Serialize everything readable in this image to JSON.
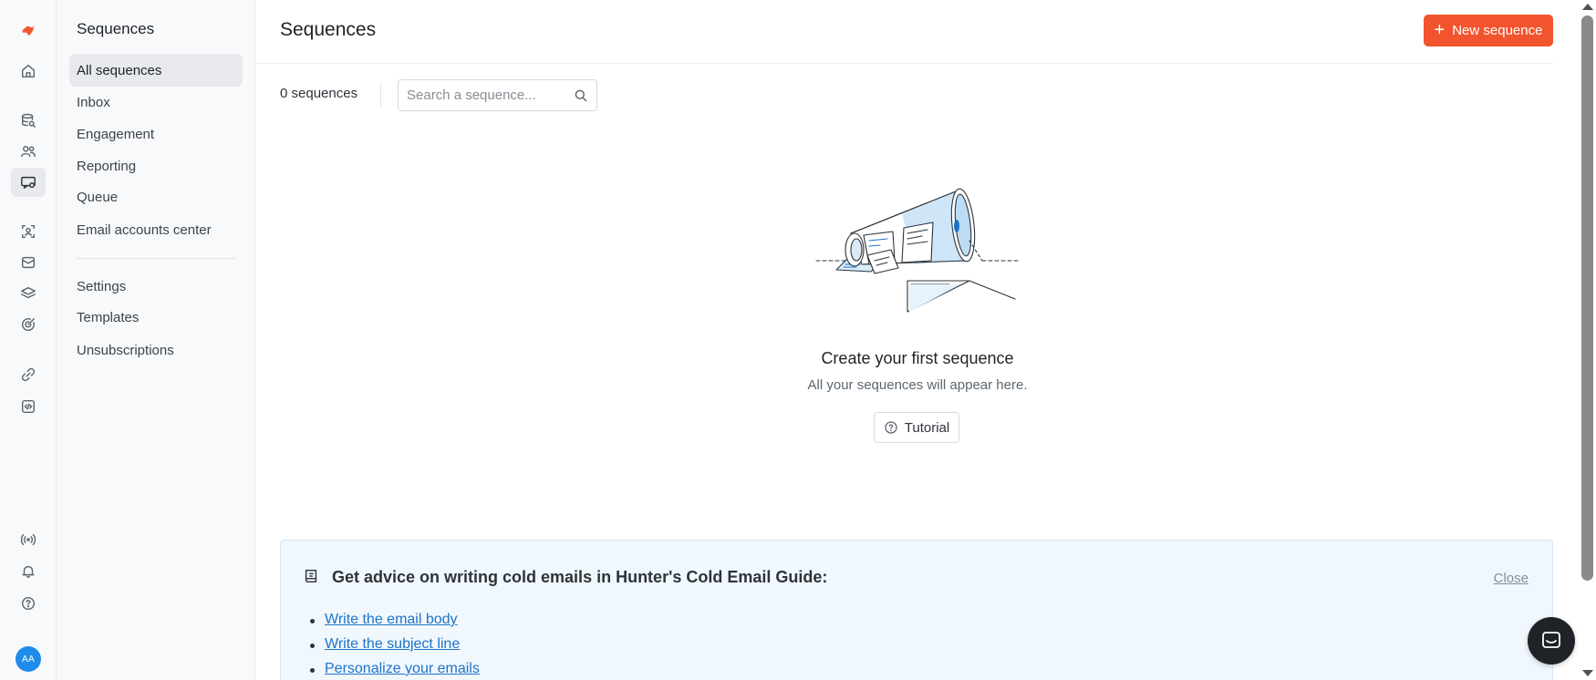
{
  "rail": {
    "logo_icon": "hunter-logo-icon",
    "items": [
      {
        "icon": "home-icon"
      },
      {
        "icon": "database-search-icon"
      },
      {
        "icon": "people-icon"
      },
      {
        "icon": "sequences-icon",
        "active": true
      },
      {
        "icon": "face-scan-icon"
      },
      {
        "icon": "mail-icon"
      },
      {
        "icon": "layers-icon"
      },
      {
        "icon": "target-icon"
      },
      {
        "icon": "integrations-icon"
      },
      {
        "icon": "api-icon"
      }
    ],
    "bottom": [
      {
        "icon": "broadcast-icon"
      },
      {
        "icon": "bell-icon"
      },
      {
        "icon": "help-icon"
      }
    ],
    "avatar_initials": "AA"
  },
  "subnav": {
    "title": "Sequences",
    "items": [
      {
        "label": "All sequences",
        "active": true
      },
      {
        "label": "Inbox"
      },
      {
        "label": "Engagement"
      },
      {
        "label": "Reporting"
      },
      {
        "label": "Queue"
      },
      {
        "label": "Email accounts center"
      }
    ],
    "settings_items": [
      {
        "label": "Settings"
      },
      {
        "label": "Templates"
      },
      {
        "label": "Unsubscriptions"
      }
    ]
  },
  "header": {
    "title": "Sequences",
    "new_button_label": "New sequence"
  },
  "toolbar": {
    "count_label": "0 sequences",
    "search_placeholder": "Search a sequence..."
  },
  "empty_state": {
    "title": "Create your first sequence",
    "subtitle": "All your sequences will appear here.",
    "tutorial_label": "Tutorial"
  },
  "guide": {
    "title": "Get advice on writing cold emails in Hunter's Cold Email Guide:",
    "close_label": "Close",
    "links": [
      {
        "label": "Write the email body"
      },
      {
        "label": "Write the subject line"
      },
      {
        "label": "Personalize your emails"
      }
    ]
  },
  "colors": {
    "accent": "#f2542d",
    "link": "#1e73c8",
    "avatar": "#1f8ceb",
    "guide_bg": "#f0f7fd"
  }
}
